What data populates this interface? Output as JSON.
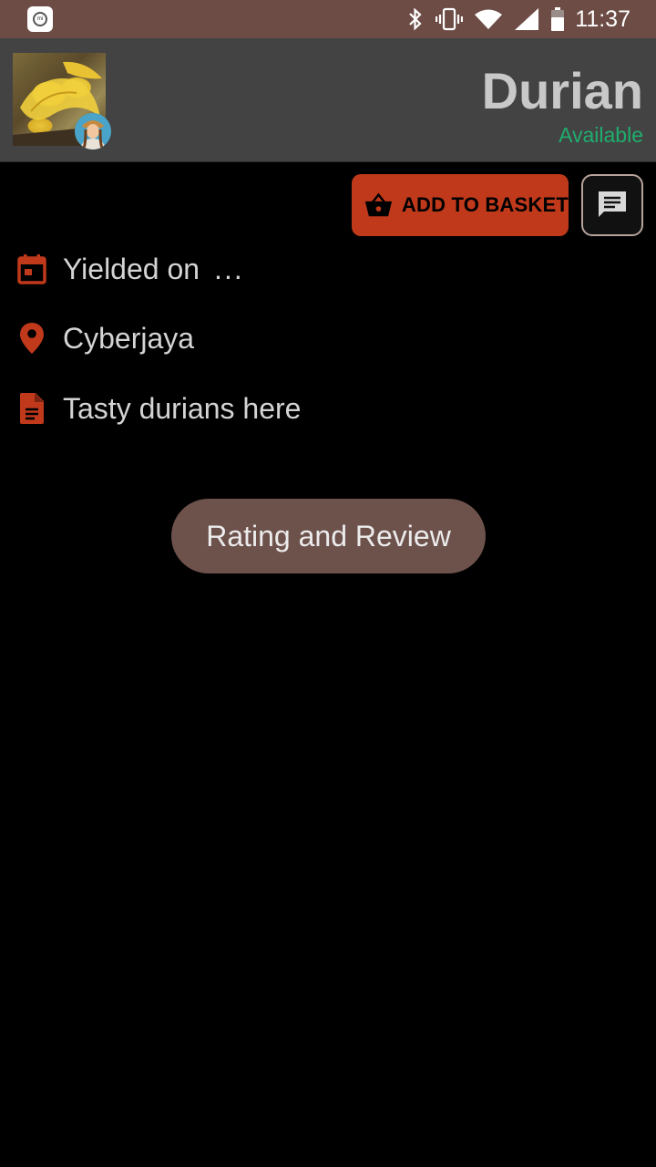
{
  "status_bar": {
    "time": "11:37",
    "icons": [
      "mi-app-icon",
      "bluetooth-icon",
      "vibrate-icon",
      "wifi-icon",
      "signal-icon",
      "battery-icon"
    ],
    "background": "#6d4c45"
  },
  "product": {
    "name": "Durian",
    "availability": "Available",
    "availability_color": "#1fae6e",
    "photo_icon": "durian-photo",
    "avatar_icon": "farmer-avatar"
  },
  "actions": {
    "add_to_basket_label": "ADD TO BASKET",
    "add_to_basket_color": "#c0391b",
    "chat_icon": "chat-icon"
  },
  "details": {
    "yield_label": "Yielded on",
    "yield_value": "...",
    "location": "Cyberjaya",
    "description": "Tasty durians here",
    "icon_color": "#c0391b"
  },
  "rating": {
    "button_label": "Rating and Review"
  }
}
